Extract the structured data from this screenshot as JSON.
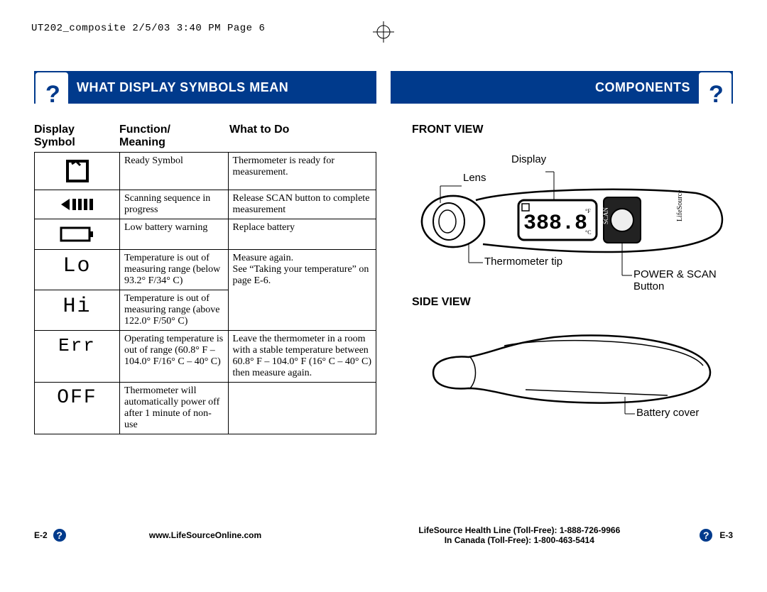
{
  "slug": "UT202_composite  2/5/03  3:40 PM  Page 6",
  "left_title": "WHAT DISPLAY SYMBOLS MEAN",
  "right_title": "COMPONENTS",
  "table_headers": {
    "col1_a": "Display",
    "col1_b": "Symbol",
    "col2_a": "Function/",
    "col2_b": "Meaning",
    "col3_a": "What to Do",
    "col3_b": ""
  },
  "rows": [
    {
      "symbol_text": "",
      "function": "Ready Symbol",
      "action": "Thermometer is ready for measurement."
    },
    {
      "symbol_text": "",
      "function": "Scanning sequence in progress",
      "action": "Release SCAN button to complete measurement"
    },
    {
      "symbol_text": "",
      "function": "Low battery warning",
      "action": "Replace battery"
    },
    {
      "symbol_text": "Lo",
      "function": "Temperature is out of measuring range (below 93.2° F/34° C)",
      "action": "Measure again.\nSee “Taking your temperature” on page E-6."
    },
    {
      "symbol_text": "Hi",
      "function": "Temperature is out of measuring range (above 122.0° F/50° C)",
      "action": ""
    },
    {
      "symbol_text": "Err",
      "function": "Operating temperature is out of range (60.8° F – 104.0° F/16° C – 40° C)",
      "action": "Leave the thermometer in a room with a stable temperature between 60.8° F – 104.0° F (16° C – 40° C) then measure again."
    },
    {
      "symbol_text": "OFF",
      "function": "Thermometer will automatically power off after 1 minute of non-use",
      "action": ""
    }
  ],
  "components": {
    "front_heading": "FRONT VIEW",
    "display_label": "Display",
    "lens_label": "Lens",
    "tip_label": "Thermometer tip",
    "button_label": "POWER & SCAN Button",
    "scan_text": "SCAN",
    "brand_text": "LifeSource",
    "lcd_value": "388.8",
    "side_heading": "SIDE VIEW",
    "battery_label": "Battery cover"
  },
  "footer": {
    "left_page": "E-2",
    "url": "www.LifeSourceOnline.com",
    "health_line": "LifeSource Health Line (Toll-Free): 1-888-726-9966",
    "canada_line": "In Canada (Toll-Free): 1-800-463-5414",
    "right_page": "E-3"
  },
  "chart_data": {
    "type": "table",
    "title": "What Display Symbols Mean",
    "columns": [
      "Display Symbol",
      "Function/Meaning",
      "What to Do"
    ],
    "rows": [
      [
        "Ready icon",
        "Ready Symbol",
        "Thermometer is ready for measurement."
      ],
      [
        "Scanning bars icon",
        "Scanning sequence in progress",
        "Release SCAN button to complete measurement"
      ],
      [
        "Low battery icon",
        "Low battery warning",
        "Replace battery"
      ],
      [
        "Lo",
        "Temperature is out of measuring range (below 93.2° F/34° C)",
        "Measure again. See \"Taking your temperature\" on page E-6."
      ],
      [
        "Hi",
        "Temperature is out of measuring range (above 122.0° F/50° C)",
        ""
      ],
      [
        "Err",
        "Operating temperature is out of range (60.8° F – 104.0° F/16° C – 40° C)",
        "Leave the thermometer in a room with a stable temperature between 60.8° F – 104.0° F (16° C – 40° C) then measure again."
      ],
      [
        "OFF",
        "Thermometer will automatically power off after 1 minute of non-use",
        ""
      ]
    ]
  }
}
